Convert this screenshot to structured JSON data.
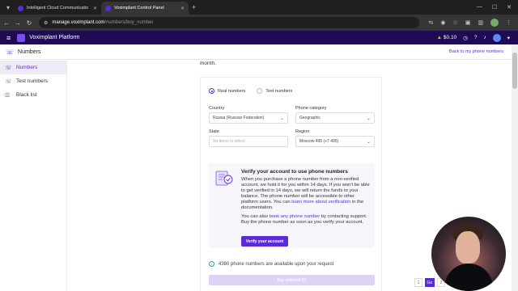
{
  "browser": {
    "tabs": [
      {
        "label": "Intelligent Cloud Communicatio",
        "active": false
      },
      {
        "label": "Voximplant Control Panel",
        "active": true
      }
    ],
    "url_host": "manage.voximplant.com",
    "url_path": "/numbers/buy_number"
  },
  "app": {
    "name": "Voximplant Platform",
    "balance": "$0.10"
  },
  "subheader": {
    "title": "Numbers",
    "back_link": "Back to my phone numbers"
  },
  "sidebar": {
    "items": [
      {
        "label": "Numbers",
        "icon": "phone-icon",
        "active": true
      },
      {
        "label": "Test numbers",
        "icon": "phone-test-icon",
        "active": false
      },
      {
        "label": "Black list",
        "icon": "list-icon",
        "active": false
      }
    ]
  },
  "main": {
    "month_text": "month.",
    "radio": {
      "real": "Real numbers",
      "test": "Test numbers",
      "selected": "real"
    },
    "country": {
      "label": "Country",
      "value": "Russia (Russian Federation)"
    },
    "category": {
      "label": "Phone category",
      "value": "Geographic"
    },
    "state": {
      "label": "State",
      "placeholder": "No items to select"
    },
    "region": {
      "label": "Region",
      "value": "Moscow 495 (+7 495)"
    },
    "verify": {
      "title": "Verify your account to use phone numbers",
      "text_a": "When you purchase a phone number from a non-verified account, we hold it for you within 14 days. If you won't be able to get verified in 14 days, we will return the funds to your balance. The phone number will be accessible to other platform users. You can ",
      "link_a": "learn more about verification",
      "text_b": " in the documentation.",
      "text_c": "You can also ",
      "link_c": "book any phone number",
      "text_d": " by contacting support. Buy the phone number as soon as you verify your account.",
      "button": "Verify your account"
    },
    "available": "4380 phone numbers are available upon your request",
    "buy_button": "Buy selected (0)"
  },
  "pager": {
    "first": "1",
    "go": "Go",
    "second": "2"
  },
  "colors": {
    "accent": "#5b2bd8",
    "header": "#1d0c53"
  }
}
